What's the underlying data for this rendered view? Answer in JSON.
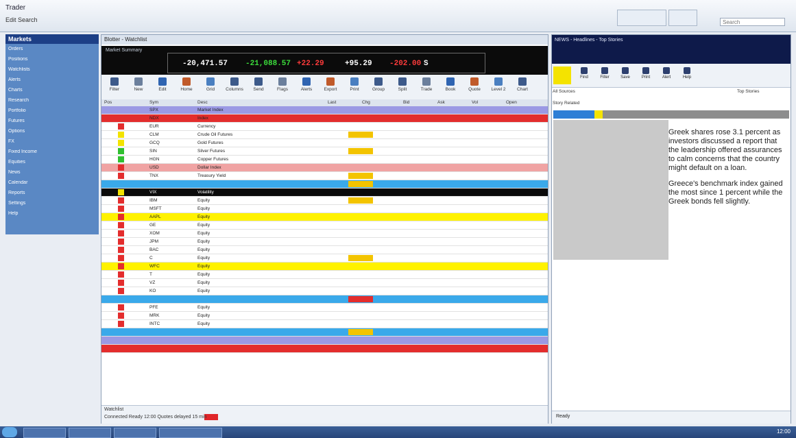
{
  "window": {
    "title": "Trader",
    "menu": "Edit  Search"
  },
  "search": {
    "placeholder": "Search"
  },
  "left_nav": {
    "header": "Markets",
    "items": [
      "Orders",
      "Positions",
      "Watchlists",
      "Alerts",
      "Charts",
      "Research",
      "Portfolio",
      "Futures",
      "Options",
      "FX",
      "Fixed Income",
      "Equities",
      "News",
      "Calendar",
      "Reports",
      "Settings",
      "Help"
    ]
  },
  "main_panel": {
    "title": "Blotter - Watchlist",
    "ticker_label": "Market Summary",
    "ticker_values": [
      {
        "value": "-20,471.57",
        "color": "#ffffff"
      },
      {
        "value": "-21,088.57",
        "color": "#3bdc3b"
      },
      {
        "value": "+22.29",
        "color": "#ff3b3b"
      },
      {
        "value": "+95.29",
        "color": "#ffffff"
      },
      {
        "value": "-202.00",
        "color": "#ff3b3b"
      },
      {
        "value": "S",
        "color": "#ffffff"
      }
    ],
    "tools": [
      "Filter",
      "New",
      "Edit",
      "Home",
      "Grid",
      "Columns",
      "Send",
      "Flags",
      "Alerts",
      "Export",
      "Print",
      "Group",
      "Split",
      "Trade",
      "Book",
      "Quote",
      "Level 2",
      "Chart"
    ],
    "columns": [
      "Pos",
      "Sym",
      "Desc",
      "Last",
      "Chg",
      "Bid",
      "Ask",
      "Vol",
      "Open"
    ],
    "footer_tab": "Watchlist",
    "footer_status": "Connected   Ready   12:00   Quotes delayed 15 min"
  },
  "rows": [
    {
      "bg": "#9b99e4",
      "flag": "",
      "sym": "SPX",
      "desc": "Market Index",
      "last": "",
      "chg": ""
    },
    {
      "bg": "#e32d2d",
      "flag": "#e32d2d",
      "sym": "NDX",
      "desc": "Index",
      "last": "",
      "chg": ""
    },
    {
      "bg": "#ffffff",
      "flag": "#e32d2d",
      "sym": "EUR",
      "desc": "Currency",
      "last": "",
      "chg": ""
    },
    {
      "bg": "#ffffff",
      "flag": "#f3e300",
      "sym": "CLM",
      "desc": "Crude Oil Futures",
      "last": "",
      "chg": "",
      "hl": "#f3c400"
    },
    {
      "bg": "#ffffff",
      "flag": "#f3e300",
      "sym": "GCQ",
      "desc": "Gold Futures",
      "last": "",
      "chg": ""
    },
    {
      "bg": "#ffffff",
      "flag": "#2fbf2f",
      "sym": "SIN",
      "desc": "Silver Futures",
      "last": "",
      "chg": "",
      "hl": "#f3c400"
    },
    {
      "bg": "#ffffff",
      "flag": "#2fbf2f",
      "sym": "HGN",
      "desc": "Copper Futures",
      "last": "",
      "chg": ""
    },
    {
      "bg": "#f0a3a3",
      "flag": "#e32d2d",
      "sym": "USD",
      "desc": "Dollar Index",
      "last": "",
      "chg": ""
    },
    {
      "bg": "#ffffff",
      "flag": "#e32d2d",
      "sym": "TNX",
      "desc": "Treasury Yield",
      "last": "",
      "chg": "",
      "hl": "#f3c400"
    },
    {
      "bg": "#3aa9ea",
      "flag": "",
      "sym": "",
      "desc": "",
      "last": "",
      "chg": "",
      "hl": "#f3c400"
    },
    {
      "bg": "#0b0b0b",
      "flag": "#f3e300",
      "sym": "VIX",
      "desc": "Volatility",
      "last": "",
      "chg": "",
      "dark": true
    },
    {
      "bg": "#ffffff",
      "flag": "#e32d2d",
      "sym": "IBM",
      "desc": "Equity",
      "last": "",
      "chg": "",
      "hl": "#f3c400"
    },
    {
      "bg": "#ffffff",
      "flag": "#e32d2d",
      "sym": "MSFT",
      "desc": "Equity",
      "last": "",
      "chg": ""
    },
    {
      "bg": "#fff200",
      "flag": "#e32d2d",
      "sym": "AAPL",
      "desc": "Equity",
      "last": "",
      "chg": ""
    },
    {
      "bg": "#ffffff",
      "flag": "#e32d2d",
      "sym": "GE",
      "desc": "Equity",
      "last": "",
      "chg": ""
    },
    {
      "bg": "#ffffff",
      "flag": "#e32d2d",
      "sym": "XOM",
      "desc": "Equity",
      "last": "",
      "chg": ""
    },
    {
      "bg": "#ffffff",
      "flag": "#e32d2d",
      "sym": "JPM",
      "desc": "Equity",
      "last": "",
      "chg": ""
    },
    {
      "bg": "#ffffff",
      "flag": "#e32d2d",
      "sym": "BAC",
      "desc": "Equity",
      "last": "",
      "chg": ""
    },
    {
      "bg": "#ffffff",
      "flag": "#e32d2d",
      "sym": "C",
      "desc": "Equity",
      "last": "",
      "chg": "",
      "hl": "#f3c400"
    },
    {
      "bg": "#fff200",
      "flag": "#e32d2d",
      "sym": "WFC",
      "desc": "Equity",
      "last": "",
      "chg": ""
    },
    {
      "bg": "#ffffff",
      "flag": "#e32d2d",
      "sym": "T",
      "desc": "Equity",
      "last": "",
      "chg": ""
    },
    {
      "bg": "#ffffff",
      "flag": "#e32d2d",
      "sym": "VZ",
      "desc": "Equity",
      "last": "",
      "chg": ""
    },
    {
      "bg": "#ffffff",
      "flag": "#e32d2d",
      "sym": "KO",
      "desc": "Equity",
      "last": "",
      "chg": ""
    },
    {
      "bg": "#3aa9ea",
      "flag": "",
      "sym": "",
      "desc": "",
      "last": "",
      "chg": "",
      "hl": "#e32d2d"
    },
    {
      "bg": "#ffffff",
      "flag": "#e32d2d",
      "sym": "PFE",
      "desc": "Equity",
      "last": "",
      "chg": ""
    },
    {
      "bg": "#ffffff",
      "flag": "#e32d2d",
      "sym": "MRK",
      "desc": "Equity",
      "last": "",
      "chg": ""
    },
    {
      "bg": "#ffffff",
      "flag": "#e32d2d",
      "sym": "INTC",
      "desc": "Equity",
      "last": "",
      "chg": ""
    },
    {
      "bg": "#3aa9ea",
      "flag": "",
      "sym": "",
      "desc": "",
      "last": "",
      "chg": "",
      "hl": "#f3c400"
    },
    {
      "bg": "#9b99e4",
      "flag": "",
      "sym": "",
      "desc": "",
      "last": "",
      "chg": ""
    },
    {
      "bg": "#e32d2d",
      "flag": "",
      "sym": "",
      "desc": "",
      "last": "",
      "chg": ""
    }
  ],
  "news_panel": {
    "header": "NEWS - Headlines - Top Stories",
    "tools": [
      "Find",
      "Filter",
      "Save",
      "Print",
      "Alert",
      "Help"
    ],
    "search_label": "All Sources",
    "count_label": "Top Stories",
    "tabs": "Story  Related",
    "story_paragraphs": [
      "Greek shares rose 3.1 percent as investors discussed a report that the leadership offered assurances to calm concerns that the country might default on a loan.",
      "Greece's benchmark index gained the most since 1 percent while the Greek bonds fell slightly."
    ],
    "footer": "Ready"
  },
  "taskbar": {
    "clock": "12:00"
  }
}
